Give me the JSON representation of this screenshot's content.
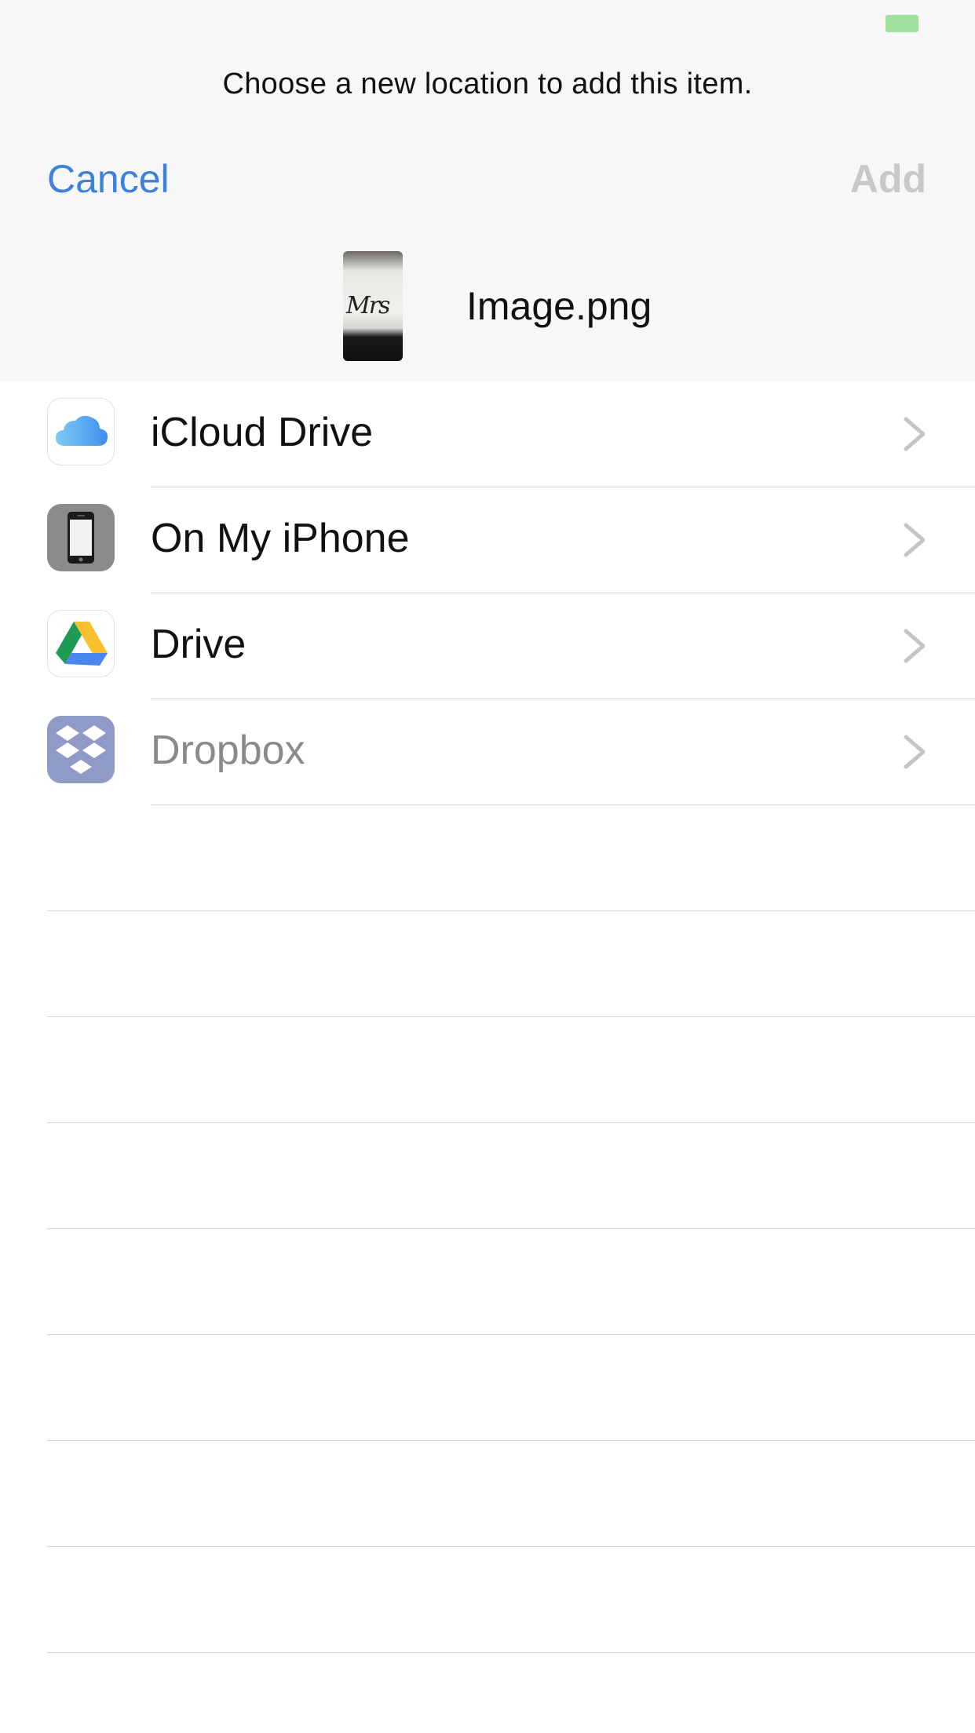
{
  "header": {
    "prompt": "Choose a new location to add this item.",
    "cancel_label": "Cancel",
    "add_label": "Add",
    "file_name": "Image.png",
    "thumbnail_text": "Mrs"
  },
  "locations": [
    {
      "label": "iCloud Drive",
      "icon": "icloud-icon"
    },
    {
      "label": "On My iPhone",
      "icon": "iphone-icon"
    },
    {
      "label": "Drive",
      "icon": "google-drive-icon"
    },
    {
      "label": "Dropbox",
      "icon": "dropbox-icon"
    }
  ],
  "colors": {
    "accent": "#3c82da",
    "disabled": "#c8c8c8",
    "battery": "#9fe09c"
  }
}
